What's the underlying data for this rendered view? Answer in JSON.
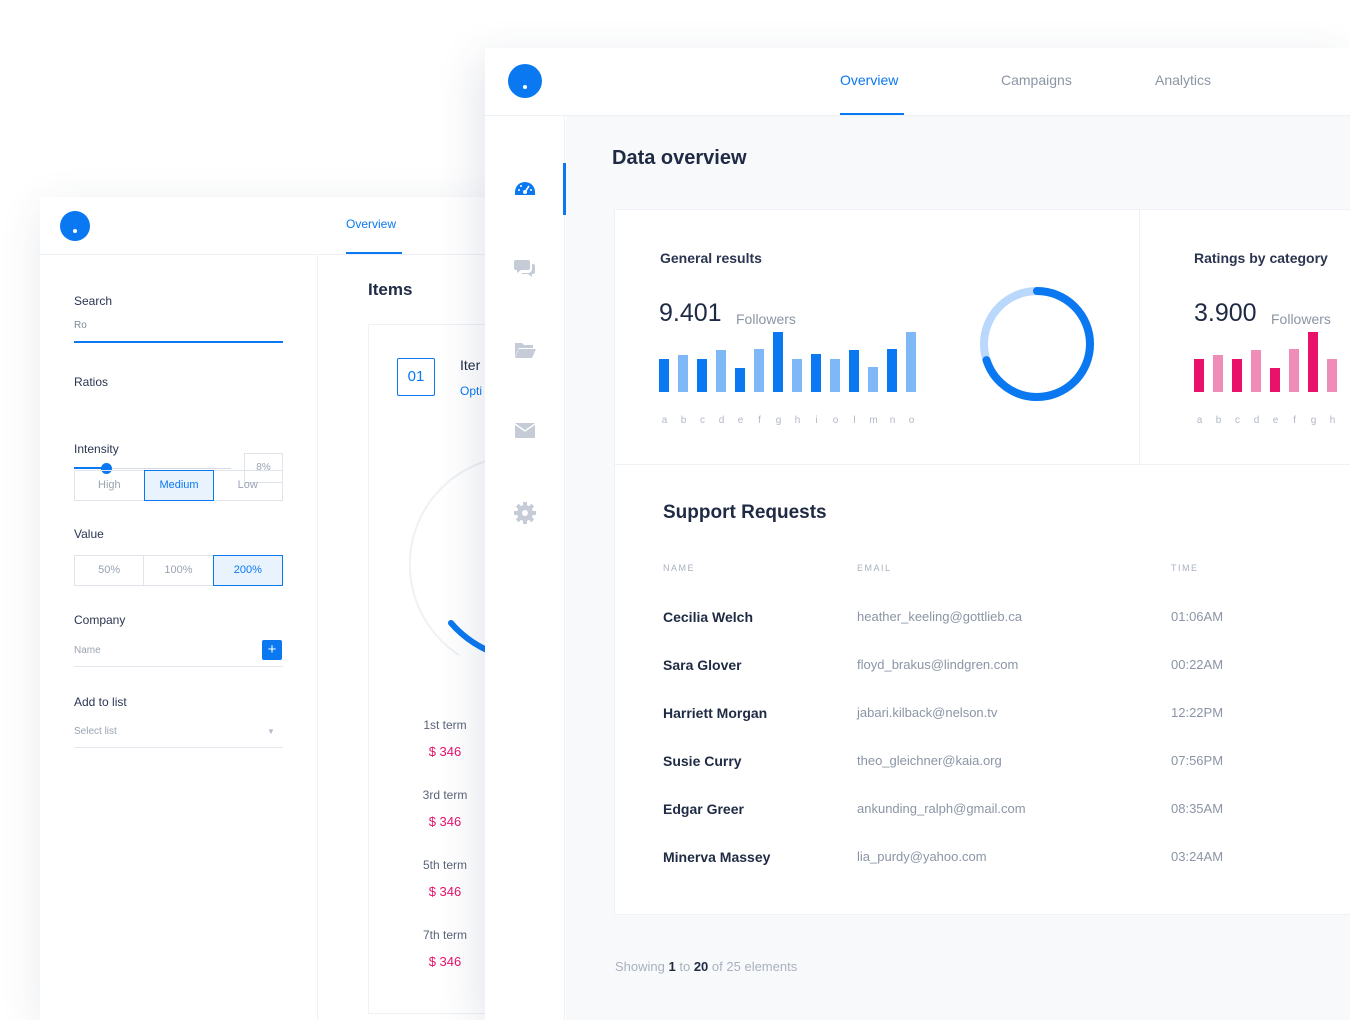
{
  "back_window": {
    "tab_overview": "Overview",
    "search": {
      "label": "Search",
      "value": "Ro"
    },
    "ratios": {
      "label": "Ratios",
      "value": "8%"
    },
    "intensity": {
      "label": "Intensity",
      "options": [
        "High",
        "Medium",
        "Low"
      ],
      "selected": "Medium"
    },
    "value": {
      "label": "Value",
      "options": [
        "50%",
        "100%",
        "200%"
      ],
      "selected": "200%"
    },
    "company": {
      "label": "Company",
      "placeholder": "Name",
      "add_button": "+"
    },
    "add_to_list": {
      "label": "Add to list",
      "placeholder": "Select list"
    },
    "items": {
      "title": "Items",
      "number": "01",
      "item_head": "Iter",
      "item_sub": "Opti",
      "terms": [
        {
          "label": "1st term",
          "value": "$ 346"
        },
        {
          "label": "3rd term",
          "value": "$ 346"
        },
        {
          "label": "5th term",
          "value": "$ 346"
        },
        {
          "label": "7th term",
          "value": "$ 346"
        }
      ]
    }
  },
  "front_window": {
    "tabs": [
      "Overview",
      "Campaigns",
      "Analytics"
    ],
    "active_tab": "Overview",
    "sidebar_icons": [
      "dashboard-icon",
      "chat-icon",
      "folder-icon",
      "mail-icon",
      "settings-icon"
    ],
    "page_title": "Data overview",
    "general_results": {
      "title": "General results",
      "number": "9.401",
      "unit": "Followers",
      "donut_progress": 0.7
    },
    "ratings": {
      "title": "Ratings by category",
      "number": "3.900",
      "unit": "Followers"
    },
    "support": {
      "title": "Support Requests",
      "columns": [
        "NAME",
        "EMAIL",
        "TIME"
      ],
      "rows": [
        {
          "name": "Cecilia Welch",
          "email": "heather_keeling@gottlieb.ca",
          "time": "01:06AM"
        },
        {
          "name": "Sara Glover",
          "email": "floyd_brakus@lindgren.com",
          "time": "00:22AM"
        },
        {
          "name": "Harriett Morgan",
          "email": "jabari.kilback@nelson.tv",
          "time": "12:22PM"
        },
        {
          "name": "Susie Curry",
          "email": "theo_gleichner@kaia.org",
          "time": "07:56PM"
        },
        {
          "name": "Edgar Greer",
          "email": "ankunding_ralph@gmail.com",
          "time": "08:35AM"
        },
        {
          "name": "Minerva Massey",
          "email": "lia_purdy@yahoo.com",
          "time": "03:24AM"
        }
      ]
    },
    "paging": {
      "showing": "Showing",
      "from": "1",
      "to_word": "to",
      "to": "20",
      "of_word": "of",
      "total": "25 elements"
    }
  },
  "colors": {
    "accent": "#0a78f0",
    "accent_light": "#7fb8f7",
    "pink": "#e8126b",
    "pink_light": "#f08cb8"
  },
  "chart_data": [
    {
      "type": "bar",
      "title": "General results",
      "categories": [
        "a",
        "b",
        "c",
        "d",
        "e",
        "f",
        "g",
        "h",
        "i",
        "o",
        "l",
        "m",
        "n",
        "o"
      ],
      "values": [
        33,
        37,
        33,
        42,
        24,
        43,
        60,
        33,
        38,
        33,
        42,
        25,
        43,
        60
      ],
      "highlight": [
        true,
        false,
        true,
        false,
        true,
        false,
        true,
        false,
        true,
        false,
        true,
        false,
        true,
        false
      ]
    },
    {
      "type": "bar",
      "title": "Ratings by category",
      "categories": [
        "a",
        "b",
        "c",
        "d",
        "e",
        "f",
        "g",
        "h"
      ],
      "values": [
        33,
        37,
        33,
        42,
        24,
        43,
        60,
        33
      ],
      "highlight": [
        true,
        false,
        true,
        false,
        true,
        false,
        true,
        false
      ]
    }
  ]
}
